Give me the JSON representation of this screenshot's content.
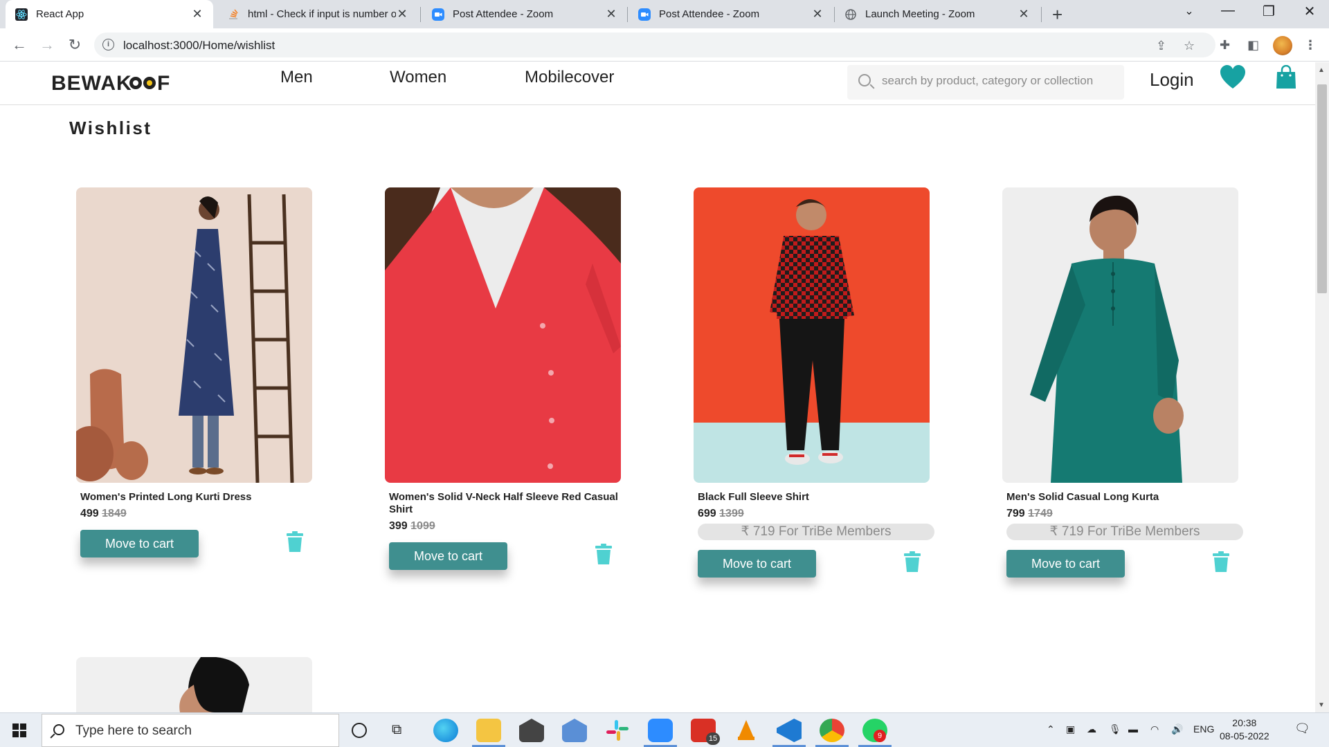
{
  "browser": {
    "tabs": [
      {
        "title": "React App",
        "close": "✕"
      },
      {
        "title": "html - Check if input is number o",
        "close": "✕"
      },
      {
        "title": "Post Attendee - Zoom",
        "close": "✕"
      },
      {
        "title": "Post Attendee - Zoom",
        "close": "✕"
      },
      {
        "title": "Launch Meeting - Zoom",
        "close": "✕"
      }
    ],
    "new_tab": "+",
    "url": "localhost:3000/Home/wishlist",
    "info_glyph": "i",
    "icons": [
      "back-arrow-icon",
      "forward-arrow-icon",
      "reload-icon",
      "share-icon",
      "star-icon",
      "extensions-icon",
      "sidepanel-icon",
      "profile-avatar",
      "menu-dots-icon"
    ]
  },
  "header": {
    "logo": "BeWAKOOF",
    "nav": [
      "Men",
      "Women",
      "Mobilecover"
    ],
    "search_placeholder": "search by product, category or collection",
    "login": "Login",
    "heart_color": "#17a2a2",
    "bag_color": "#17a2a2"
  },
  "wishlist": {
    "title": "Wishlist",
    "button_label": "Move to cart",
    "button_color": "#3f8f8f",
    "items": [
      {
        "name": "Women's Printed Long Kurti Dress",
        "price": "499",
        "mrp": "1849",
        "tribe": "",
        "image": "woman-blue-kurti-photo"
      },
      {
        "name": "Women's Solid V-Neck Half Sleeve Red Casual Shirt",
        "price": "399",
        "mrp": "1099",
        "tribe": "",
        "image": "red-vneck-shirt-photo"
      },
      {
        "name": "Black Full Sleeve Shirt",
        "price": "699",
        "mrp": "1399",
        "tribe": "₹ 719 For TriBe Members",
        "image": "man-checked-shirt-photo"
      },
      {
        "name": "Men's Solid Casual Long Kurta",
        "price": "799",
        "mrp": "1749",
        "tribe": "₹ 719 For TriBe Members",
        "image": "man-teal-kurta-photo"
      }
    ]
  },
  "taskbar": {
    "search_text": "Type here to search",
    "time": "20:38",
    "date": "08-05-2022",
    "lang": "ENG",
    "badges": {
      "mail": "15",
      "whatsapp": "9"
    }
  }
}
